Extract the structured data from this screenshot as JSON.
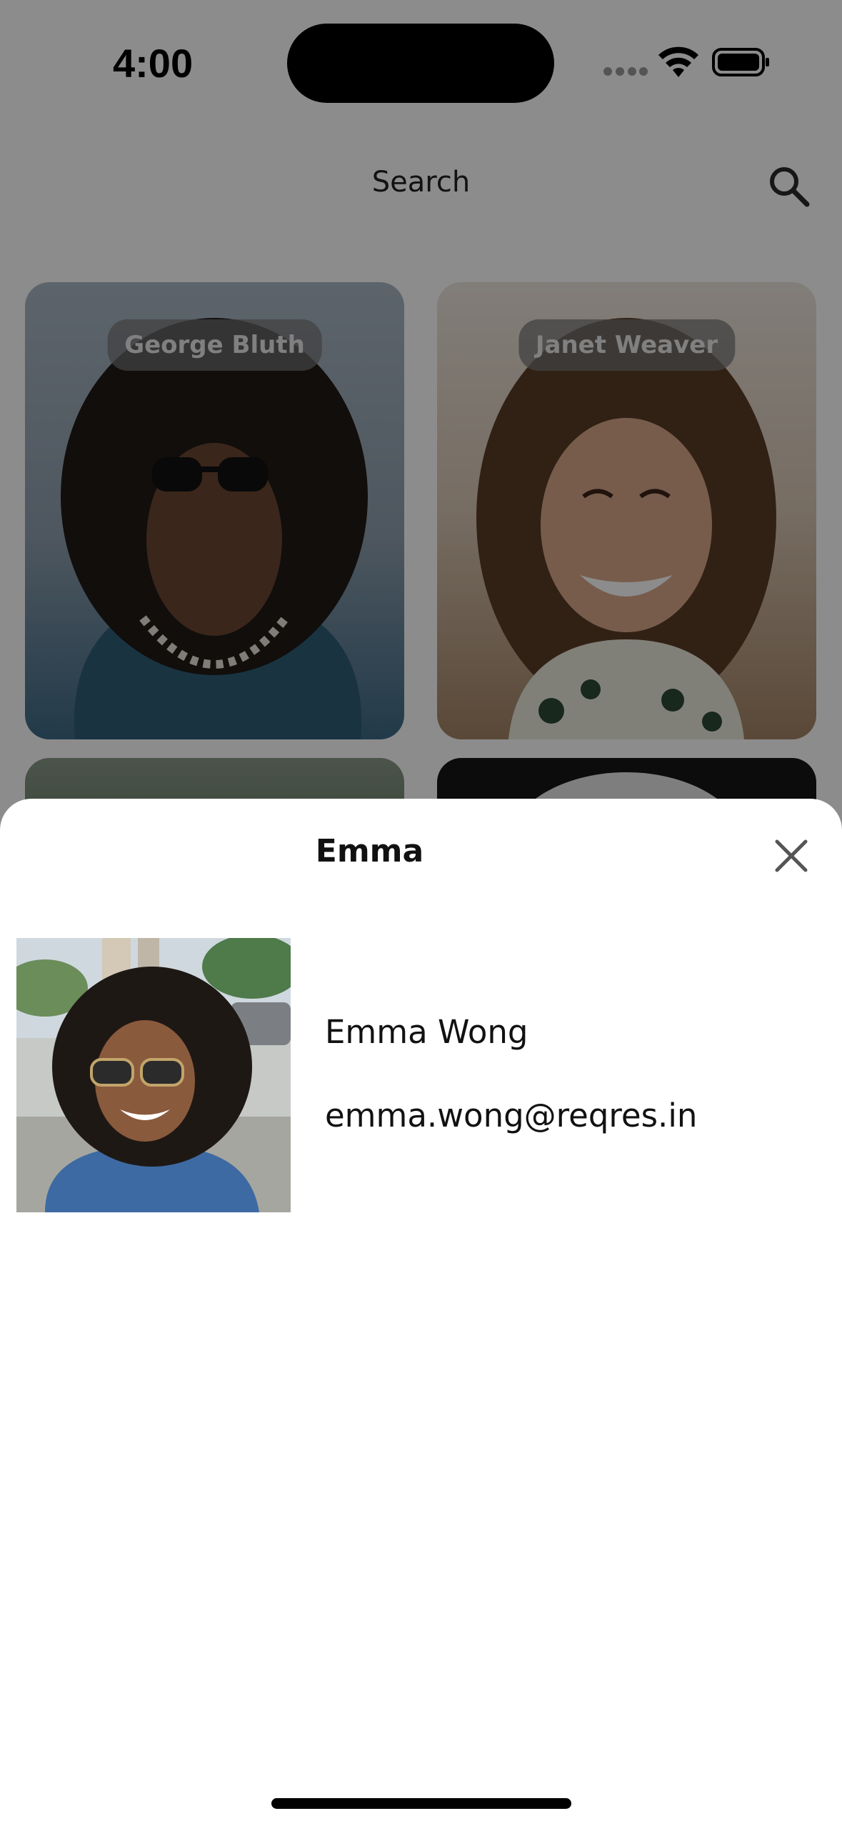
{
  "status_bar": {
    "time": "4:00",
    "icons": [
      "cellular-signal-icon",
      "wifi-icon",
      "battery-icon"
    ]
  },
  "header": {
    "title": "Search",
    "search_icon": "search-icon"
  },
  "users_grid": {
    "cards": [
      {
        "name": "George Bluth"
      },
      {
        "name": "Janet Weaver"
      },
      {
        "name": ""
      },
      {
        "name": ""
      }
    ]
  },
  "detail_sheet": {
    "title": "Emma",
    "close_icon": "close-icon",
    "full_name": "Emma Wong",
    "email": "emma.wong@reqres.in"
  },
  "colors": {
    "overlay": "#000000",
    "sheet_background": "#ffffff",
    "text": "#111111"
  }
}
